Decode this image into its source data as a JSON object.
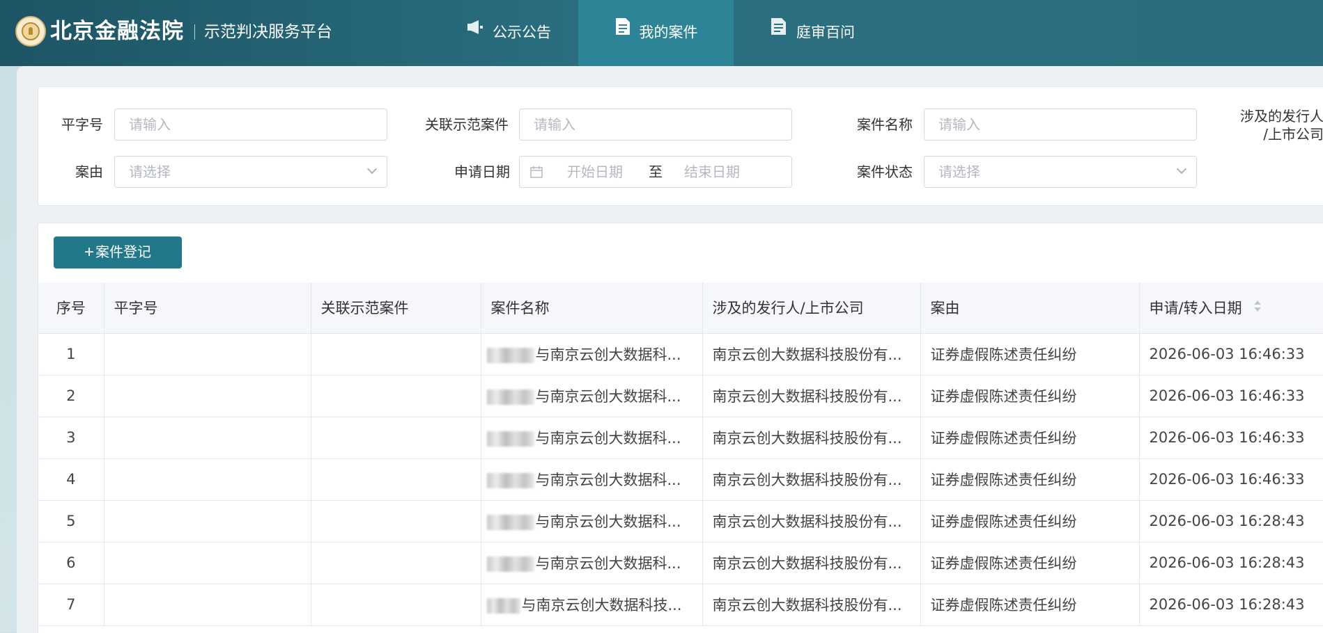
{
  "header": {
    "court_name": "北京金融法院",
    "platform_name": "示范判决服务平台",
    "nav": [
      {
        "label": "公示公告",
        "icon": "megaphone-icon",
        "active": false
      },
      {
        "label": "我的案件",
        "icon": "document-icon",
        "active": true
      },
      {
        "label": "庭审百问",
        "icon": "document-list-icon",
        "active": false
      }
    ]
  },
  "filters": {
    "case_number": {
      "label": "平字号",
      "placeholder": "请输入"
    },
    "related_case": {
      "label": "关联示范案件",
      "placeholder": "请输入"
    },
    "case_name": {
      "label": "案件名称",
      "placeholder": "请输入"
    },
    "issuer": {
      "label_line1": "涉及的发行人",
      "label_line2": "/上市公司"
    },
    "cause": {
      "label": "案由",
      "placeholder": "请选择"
    },
    "apply_date": {
      "label": "申请日期",
      "start_placeholder": "开始日期",
      "separator": "至",
      "end_placeholder": "结束日期"
    },
    "status": {
      "label": "案件状态",
      "placeholder": "请选择"
    }
  },
  "actions": {
    "add_case": "案件登记"
  },
  "table": {
    "columns": [
      "序号",
      "平字号",
      "关联示范案件",
      "案件名称",
      "涉及的发行人/上市公司",
      "案由",
      "申请/转入日期"
    ],
    "rows": [
      {
        "seq": "1",
        "case_number": "",
        "related": "",
        "name": "与南京云创大数据科...",
        "issuer": "南京云创大数据科技股份有...",
        "cause": "证券虚假陈述责任纠纷",
        "date": "2026-06-03 16:46:33"
      },
      {
        "seq": "2",
        "case_number": "",
        "related": "",
        "name": "与南京云创大数据科...",
        "issuer": "南京云创大数据科技股份有...",
        "cause": "证券虚假陈述责任纠纷",
        "date": "2026-06-03 16:46:33"
      },
      {
        "seq": "3",
        "case_number": "",
        "related": "",
        "name": "与南京云创大数据科...",
        "issuer": "南京云创大数据科技股份有...",
        "cause": "证券虚假陈述责任纠纷",
        "date": "2026-06-03 16:46:33"
      },
      {
        "seq": "4",
        "case_number": "",
        "related": "",
        "name": "与南京云创大数据科...",
        "issuer": "南京云创大数据科技股份有...",
        "cause": "证券虚假陈述责任纠纷",
        "date": "2026-06-03 16:46:33"
      },
      {
        "seq": "5",
        "case_number": "",
        "related": "",
        "name": "与南京云创大数据科...",
        "issuer": "南京云创大数据科技股份有...",
        "cause": "证券虚假陈述责任纠纷",
        "date": "2026-06-03 16:28:43"
      },
      {
        "seq": "6",
        "case_number": "",
        "related": "",
        "name": "与南京云创大数据科...",
        "issuer": "南京云创大数据科技股份有...",
        "cause": "证券虚假陈述责任纠纷",
        "date": "2026-06-03 16:28:43"
      },
      {
        "seq": "7",
        "case_number": "",
        "related": "",
        "name": "与南京云创大数据科技...",
        "issuer": "南京云创大数据科技股份有...",
        "cause": "证券虚假陈述责任纠纷",
        "date": "2026-06-03 16:28:43"
      }
    ]
  },
  "colors": {
    "header_bg": "#2a6f80",
    "nav_active_bg": "#2c8496",
    "primary_button": "#22788b"
  }
}
